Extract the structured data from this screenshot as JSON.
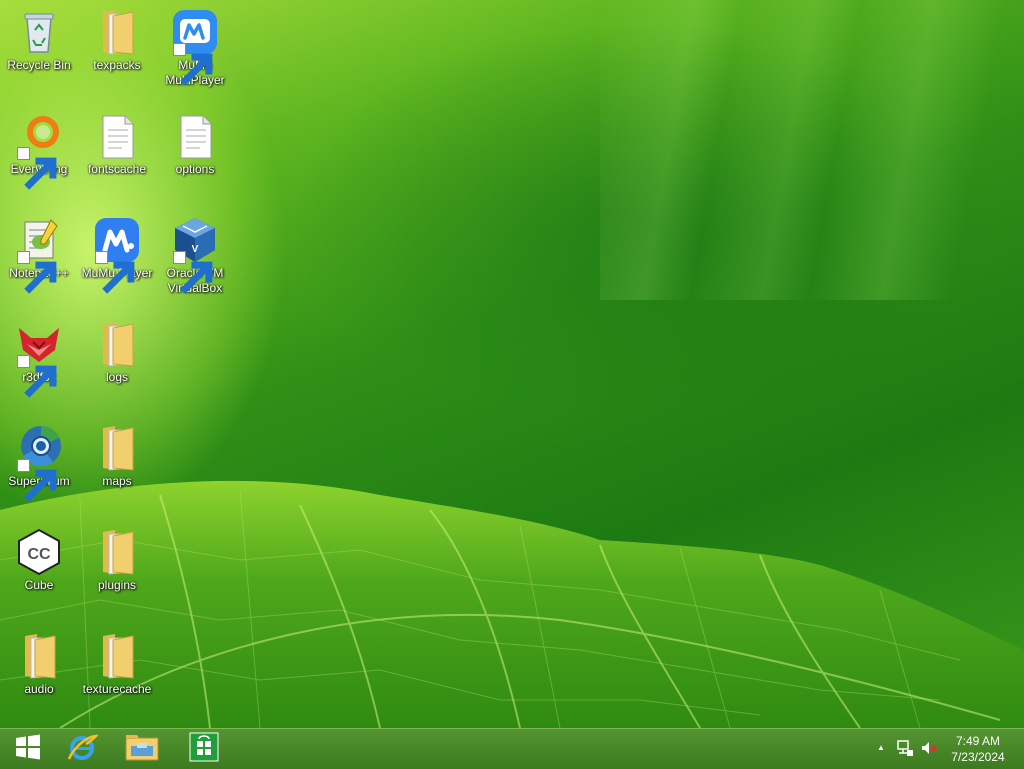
{
  "desktop": {
    "icons": [
      {
        "label": "Recycle Bin",
        "icon": "recycle-bin-icon"
      },
      {
        "label": "texpacks",
        "icon": "folder-icon"
      },
      {
        "label": "MuMu\nMultiPlayer",
        "icon": "mumu-multiplayer-icon"
      },
      {
        "label": "Everything",
        "icon": "everything-search-icon"
      },
      {
        "label": "fontscache",
        "icon": "file-icon"
      },
      {
        "label": "options",
        "icon": "file-icon"
      },
      {
        "label": "Notepad++",
        "icon": "notepadpp-icon"
      },
      {
        "label": "MuMu Player",
        "icon": "mumu-player-icon"
      },
      {
        "label": "Oracle VM\nVirtualBox",
        "icon": "virtualbox-icon"
      },
      {
        "label": "r3dfox",
        "icon": "r3dfox-icon"
      },
      {
        "label": "logs",
        "icon": "folder-icon"
      },
      {
        "label": "Supermium",
        "icon": "supermium-icon"
      },
      {
        "label": "maps",
        "icon": "folder-icon"
      },
      {
        "label": "Cube",
        "icon": "cube-icon"
      },
      {
        "label": "plugins",
        "icon": "folder-icon"
      },
      {
        "label": "audio",
        "icon": "folder-icon"
      },
      {
        "label": "texturecache",
        "icon": "folder-icon"
      }
    ]
  },
  "taskbar": {
    "buttons": [
      {
        "name": "start-button",
        "icon": "windows-logo-icon"
      },
      {
        "name": "internet-explorer-button",
        "icon": "internet-explorer-icon"
      },
      {
        "name": "file-explorer-button",
        "icon": "file-explorer-icon"
      },
      {
        "name": "store-button",
        "icon": "store-icon"
      }
    ],
    "tray": {
      "show_hidden_arrow": "▲",
      "icons": [
        "network-icon",
        "volume-muted-icon"
      ]
    },
    "clock": {
      "time": "7:49 AM",
      "date": "7/23/2024"
    }
  },
  "colors": {
    "taskbar": "#3f8a1c",
    "folder": "#f1cf6e",
    "accent": "#1e90ff"
  }
}
